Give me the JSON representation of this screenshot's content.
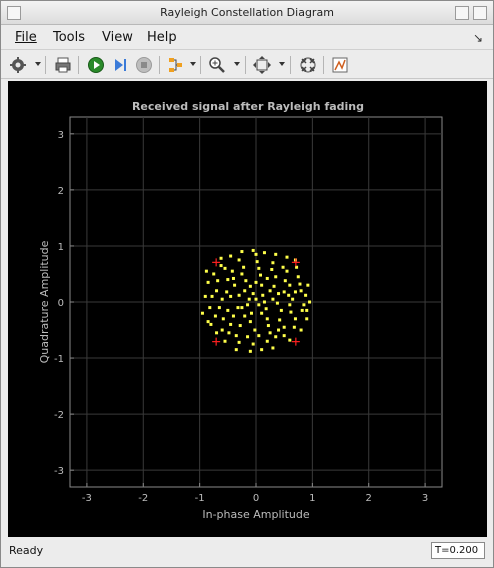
{
  "window": {
    "title": "Rayleigh Constellation Diagram"
  },
  "menubar": {
    "items": [
      "File",
      "Tools",
      "View",
      "Help"
    ]
  },
  "toolbar": {
    "icons": [
      "gear-icon",
      "print-icon",
      "run-icon",
      "step-icon",
      "stop-icon",
      "highlight-icon",
      "zoom-in-icon",
      "pan-icon",
      "reference-constellation-icon",
      "measurements-icon"
    ]
  },
  "status": {
    "text": "Ready",
    "time": "T=0.200"
  },
  "colors": {
    "plot_bg": "#000000",
    "axes_bg": "#000000",
    "points": "#ffff4a",
    "reference": "#ff2020",
    "grid": "#3a3a3a"
  },
  "chart_data": {
    "type": "scatter",
    "title": "Received signal after Rayleigh fading",
    "xlabel": "In-phase Amplitude",
    "ylabel": "Quadrature Amplitude",
    "xlim": [
      -3.3,
      3.3
    ],
    "ylim": [
      -3.3,
      3.3
    ],
    "xticks": [
      "-3",
      "-2",
      "-1",
      "0",
      "1",
      "2",
      "3"
    ],
    "yticks": [
      "3",
      "2",
      "1",
      "0",
      "-1",
      "-2",
      "-3"
    ],
    "grid": true,
    "reference_points": [
      [
        -0.707,
        0.707
      ],
      [
        0.707,
        0.707
      ],
      [
        -0.707,
        -0.707
      ],
      [
        0.707,
        -0.707
      ]
    ],
    "series": [
      {
        "points": [
          [
            -0.85,
            0.35
          ],
          [
            -0.9,
            0.1
          ],
          [
            -0.95,
            -0.2
          ],
          [
            -0.8,
            -0.4
          ],
          [
            -0.75,
            0.5
          ],
          [
            -0.7,
            0.2
          ],
          [
            -0.65,
            -0.1
          ],
          [
            -0.6,
            -0.5
          ],
          [
            -0.55,
            0.6
          ],
          [
            -0.5,
            0.4
          ],
          [
            -0.45,
            0.1
          ],
          [
            -0.4,
            -0.25
          ],
          [
            -0.35,
            -0.6
          ],
          [
            -0.3,
            0.75
          ],
          [
            -0.25,
            0.5
          ],
          [
            -0.2,
            0.2
          ],
          [
            -0.15,
            -0.05
          ],
          [
            -0.1,
            -0.35
          ],
          [
            -0.05,
            -0.75
          ],
          [
            0.0,
            0.85
          ],
          [
            0.05,
            0.6
          ],
          [
            0.1,
            0.3
          ],
          [
            0.15,
            0.0
          ],
          [
            0.2,
            -0.3
          ],
          [
            0.25,
            -0.55
          ],
          [
            0.3,
            0.7
          ],
          [
            0.35,
            0.45
          ],
          [
            0.4,
            0.15
          ],
          [
            0.45,
            -0.15
          ],
          [
            0.5,
            -0.45
          ],
          [
            0.55,
            0.55
          ],
          [
            0.6,
            0.3
          ],
          [
            0.65,
            0.05
          ],
          [
            0.7,
            -0.3
          ],
          [
            0.75,
            0.45
          ],
          [
            0.8,
            0.2
          ],
          [
            0.85,
            -0.05
          ],
          [
            0.9,
            -0.3
          ],
          [
            0.92,
            0.3
          ],
          [
            0.95,
            0.0
          ],
          [
            -0.88,
            0.55
          ],
          [
            -0.82,
            -0.1
          ],
          [
            -0.78,
            0.1
          ],
          [
            -0.72,
            -0.25
          ],
          [
            -0.68,
            0.38
          ],
          [
            -0.62,
            0.65
          ],
          [
            -0.58,
            -0.3
          ],
          [
            -0.52,
            0.18
          ],
          [
            -0.48,
            -0.55
          ],
          [
            -0.42,
            0.55
          ],
          [
            -0.38,
            0.3
          ],
          [
            -0.32,
            -0.1
          ],
          [
            -0.28,
            -0.42
          ],
          [
            -0.22,
            0.62
          ],
          [
            -0.18,
            0.38
          ],
          [
            -0.12,
            0.05
          ],
          [
            -0.08,
            -0.2
          ],
          [
            -0.02,
            -0.5
          ],
          [
            0.02,
            0.72
          ],
          [
            0.08,
            0.48
          ],
          [
            0.12,
            0.12
          ],
          [
            0.18,
            -0.12
          ],
          [
            0.22,
            -0.42
          ],
          [
            0.28,
            0.58
          ],
          [
            0.32,
            0.28
          ],
          [
            0.38,
            -0.02
          ],
          [
            0.42,
            -0.32
          ],
          [
            0.48,
            0.62
          ],
          [
            0.52,
            0.38
          ],
          [
            0.58,
            0.12
          ],
          [
            0.62,
            -0.18
          ],
          [
            0.68,
            -0.45
          ],
          [
            0.72,
            0.62
          ],
          [
            0.78,
            0.32
          ],
          [
            0.82,
            -0.15
          ],
          [
            0.88,
            0.12
          ],
          [
            -0.6,
            0.05
          ],
          [
            -0.5,
            -0.15
          ],
          [
            -0.4,
            0.42
          ],
          [
            -0.3,
            0.12
          ],
          [
            -0.2,
            -0.25
          ],
          [
            -0.1,
            0.28
          ],
          [
            0.0,
            0.05
          ],
          [
            0.1,
            -0.2
          ],
          [
            0.2,
            0.42
          ],
          [
            0.3,
            0.05
          ],
          [
            0.4,
            -0.5
          ],
          [
            0.5,
            0.18
          ],
          [
            0.6,
            -0.05
          ],
          [
            0.7,
            0.18
          ],
          [
            -0.7,
            -0.55
          ],
          [
            -0.55,
            -0.7
          ],
          [
            -0.3,
            -0.72
          ],
          [
            -0.15,
            -0.62
          ],
          [
            0.05,
            -0.6
          ],
          [
            0.2,
            -0.7
          ],
          [
            0.35,
            -0.62
          ],
          [
            0.5,
            -0.6
          ],
          [
            0.6,
            -0.68
          ],
          [
            -0.45,
            -0.4
          ],
          [
            -0.25,
            0.9
          ],
          [
            -0.05,
            0.92
          ],
          [
            0.15,
            0.88
          ],
          [
            0.35,
            0.85
          ],
          [
            0.55,
            0.8
          ],
          [
            -0.45,
            0.82
          ],
          [
            -0.62,
            0.78
          ],
          [
            0.7,
            0.75
          ],
          [
            0.8,
            -0.5
          ],
          [
            -0.35,
            -0.85
          ],
          [
            -0.1,
            -0.88
          ],
          [
            0.1,
            -0.85
          ],
          [
            0.3,
            -0.82
          ],
          [
            -0.85,
            -0.35
          ],
          [
            0.9,
            -0.15
          ],
          [
            0.0,
            0.35
          ],
          [
            0.05,
            -0.05
          ],
          [
            -0.05,
            0.15
          ],
          [
            0.25,
            0.2
          ],
          [
            -0.25,
            -0.1
          ]
        ]
      }
    ]
  }
}
